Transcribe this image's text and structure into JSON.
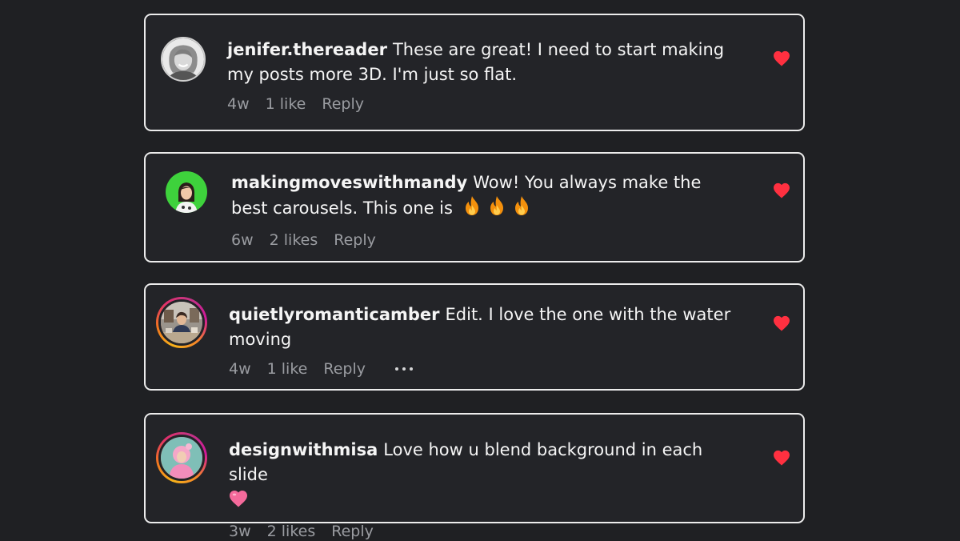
{
  "theme": {
    "background": "#1f2023",
    "card_border": "#ececec",
    "meta_text": "#9a9ca1",
    "like_color": "#ff3040"
  },
  "comments": [
    {
      "username": "jenifer.thereader",
      "text": "These are great! I need to start making my posts more 3D. I'm just so flat.",
      "age": "4w",
      "likes": "1 like",
      "reply": "Reply",
      "avatar": "woman-portrait-grayscale",
      "liked": true
    },
    {
      "username": "makingmoveswithmandy",
      "text": "Wow! You always make the best carousels. This one is",
      "emojis": [
        "fire-emoji",
        "fire-emoji",
        "fire-emoji"
      ],
      "age": "6w",
      "likes": "2 likes",
      "reply": "Reply",
      "avatar": "woman-green-background",
      "liked": true
    },
    {
      "username": "quietlyromanticamber",
      "text": "Edit. I love the one with the water moving",
      "age": "4w",
      "likes": "1 like",
      "reply": "Reply",
      "avatar": "woman-in-room-story-ring",
      "liked": true,
      "has_more_options": true
    },
    {
      "username": "designwithmisa",
      "text": "Love how u blend background in each slide",
      "emojis": [
        "pink-heart-emoji"
      ],
      "age": "3w",
      "likes": "2 likes",
      "reply": "Reply",
      "avatar": "woman-pink-outfit-story-ring",
      "liked": true
    }
  ]
}
